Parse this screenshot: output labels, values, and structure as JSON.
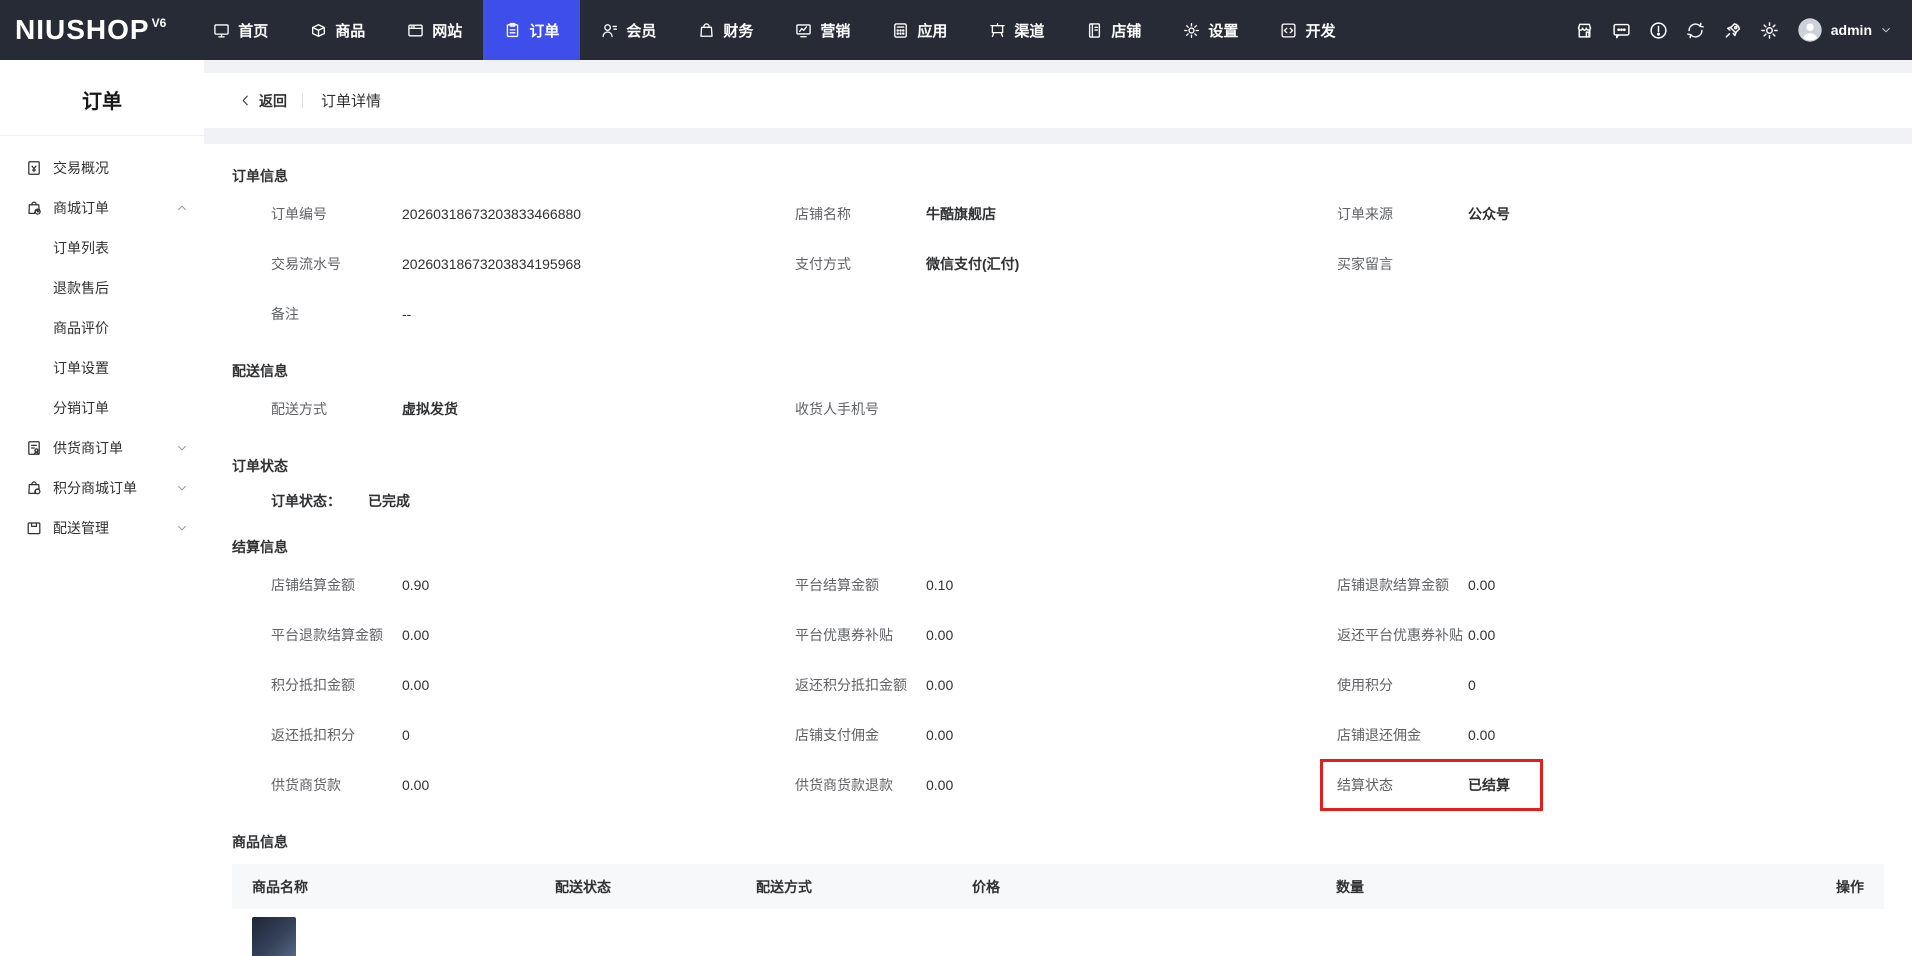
{
  "colors": {
    "accent": "#3d4eeb",
    "navbar_bg": "#262b36",
    "highlight_red": "#e01f1f"
  },
  "topnav": {
    "logo": "NIUSHOP",
    "logo_suffix": "V6",
    "items": [
      {
        "key": "home",
        "label": "首页",
        "icon": "monitor-icon",
        "active": false
      },
      {
        "key": "goods",
        "label": "商品",
        "icon": "package-icon",
        "active": false
      },
      {
        "key": "website",
        "label": "网站",
        "icon": "browser-icon",
        "active": false
      },
      {
        "key": "order",
        "label": "订单",
        "icon": "clipboard-icon",
        "active": true
      },
      {
        "key": "member",
        "label": "会员",
        "icon": "member-icon",
        "active": false
      },
      {
        "key": "finance",
        "label": "财务",
        "icon": "money-bag-icon",
        "active": false
      },
      {
        "key": "marketing",
        "label": "营销",
        "icon": "chart-screen-icon",
        "active": false
      },
      {
        "key": "apps",
        "label": "应用",
        "icon": "calculator-icon",
        "active": false
      },
      {
        "key": "channel",
        "label": "渠道",
        "icon": "easel-icon",
        "active": false
      },
      {
        "key": "shop",
        "label": "店铺",
        "icon": "shop-book-icon",
        "active": false
      },
      {
        "key": "settings",
        "label": "设置",
        "icon": "gear-icon",
        "active": false
      },
      {
        "key": "dev",
        "label": "开发",
        "icon": "code-icon",
        "active": false
      }
    ],
    "right_icons": [
      {
        "key": "storefront",
        "icon": "storefront-icon"
      },
      {
        "key": "message",
        "icon": "message-icon"
      },
      {
        "key": "alert",
        "icon": "alert-circle-icon"
      },
      {
        "key": "refresh",
        "icon": "refresh-icon"
      },
      {
        "key": "rocket",
        "icon": "rocket-icon"
      },
      {
        "key": "gear",
        "icon": "gear-icon"
      }
    ],
    "user": {
      "name": "admin"
    }
  },
  "sidebar": {
    "title": "订单",
    "items": [
      {
        "key": "trade-overview",
        "label": "交易概况",
        "icon": "doc-yen-icon",
        "level": 1,
        "chevron": null
      },
      {
        "key": "mall-order",
        "label": "商城订单",
        "icon": "bag-clock-icon",
        "level": 1,
        "chevron": "up"
      },
      {
        "key": "order-list",
        "label": "订单列表",
        "icon": null,
        "level": 2,
        "chevron": null
      },
      {
        "key": "refund-aftersale",
        "label": "退款售后",
        "icon": null,
        "level": 2,
        "chevron": null
      },
      {
        "key": "goods-review",
        "label": "商品评价",
        "icon": null,
        "level": 2,
        "chevron": null
      },
      {
        "key": "order-settings",
        "label": "订单设置",
        "icon": null,
        "level": 2,
        "chevron": null
      },
      {
        "key": "distribution-order",
        "label": "分销订单",
        "icon": null,
        "level": 2,
        "chevron": null
      },
      {
        "key": "supplier-order",
        "label": "供货商订单",
        "icon": "doc-person-icon",
        "level": 1,
        "chevron": "down"
      },
      {
        "key": "points-mall-order",
        "label": "积分商城订单",
        "icon": "bag-coin-icon",
        "level": 1,
        "chevron": "down"
      },
      {
        "key": "delivery-manage",
        "label": "配送管理",
        "icon": "box-icon",
        "level": 1,
        "chevron": "down"
      }
    ]
  },
  "page_header": {
    "back": "返回",
    "title": "订单详情"
  },
  "order_info": {
    "title": "订单信息",
    "fields": [
      {
        "label": "订单编号",
        "value": "20260318673203833466880",
        "bold": false
      },
      {
        "label": "店铺名称",
        "value": "牛酷旗舰店",
        "bold": true
      },
      {
        "label": "订单来源",
        "value": "公众号",
        "bold": true
      },
      {
        "label": "交易流水号",
        "value": "20260318673203834195968",
        "bold": false
      },
      {
        "label": "支付方式",
        "value": "微信支付(汇付)",
        "bold": true
      },
      {
        "label": "买家留言",
        "value": "",
        "bold": false
      },
      {
        "label": "备注",
        "value": "--",
        "bold": false
      }
    ]
  },
  "delivery_info": {
    "title": "配送信息",
    "fields": [
      {
        "label": "配送方式",
        "value": "虚拟发货",
        "bold": true
      },
      {
        "label": "收货人手机号",
        "value": "",
        "bold": false
      }
    ]
  },
  "order_status": {
    "title": "订单状态",
    "label": "订单状态：",
    "value": "已完成"
  },
  "settlement_info": {
    "title": "结算信息",
    "fields": [
      {
        "label": "店铺结算金额",
        "value": "0.90",
        "bold": false
      },
      {
        "label": "平台结算金额",
        "value": "0.10",
        "bold": false
      },
      {
        "label": "店铺退款结算金额",
        "value": "0.00",
        "bold": false
      },
      {
        "label": "平台退款结算金额",
        "value": "0.00",
        "bold": false
      },
      {
        "label": "平台优惠券补贴",
        "value": "0.00",
        "bold": false
      },
      {
        "label": "返还平台优惠券补贴",
        "value": "0.00",
        "bold": false
      },
      {
        "label": "积分抵扣金额",
        "value": "0.00",
        "bold": false
      },
      {
        "label": "返还积分抵扣金额",
        "value": "0.00",
        "bold": false
      },
      {
        "label": "使用积分",
        "value": "0",
        "bold": false
      },
      {
        "label": "返还抵扣积分",
        "value": "0",
        "bold": false
      },
      {
        "label": "店铺支付佣金",
        "value": "0.00",
        "bold": false
      },
      {
        "label": "店铺退还佣金",
        "value": "0.00",
        "bold": false
      },
      {
        "label": "供货商货款",
        "value": "0.00",
        "bold": false
      },
      {
        "label": "供货商货款退款",
        "value": "0.00",
        "bold": false
      },
      {
        "label": "结算状态",
        "value": "已结算",
        "bold": true,
        "highlighted": true
      }
    ]
  },
  "goods_info": {
    "title": "商品信息",
    "columns": [
      "商品名称",
      "配送状态",
      "配送方式",
      "价格",
      "数量",
      "操作"
    ]
  }
}
